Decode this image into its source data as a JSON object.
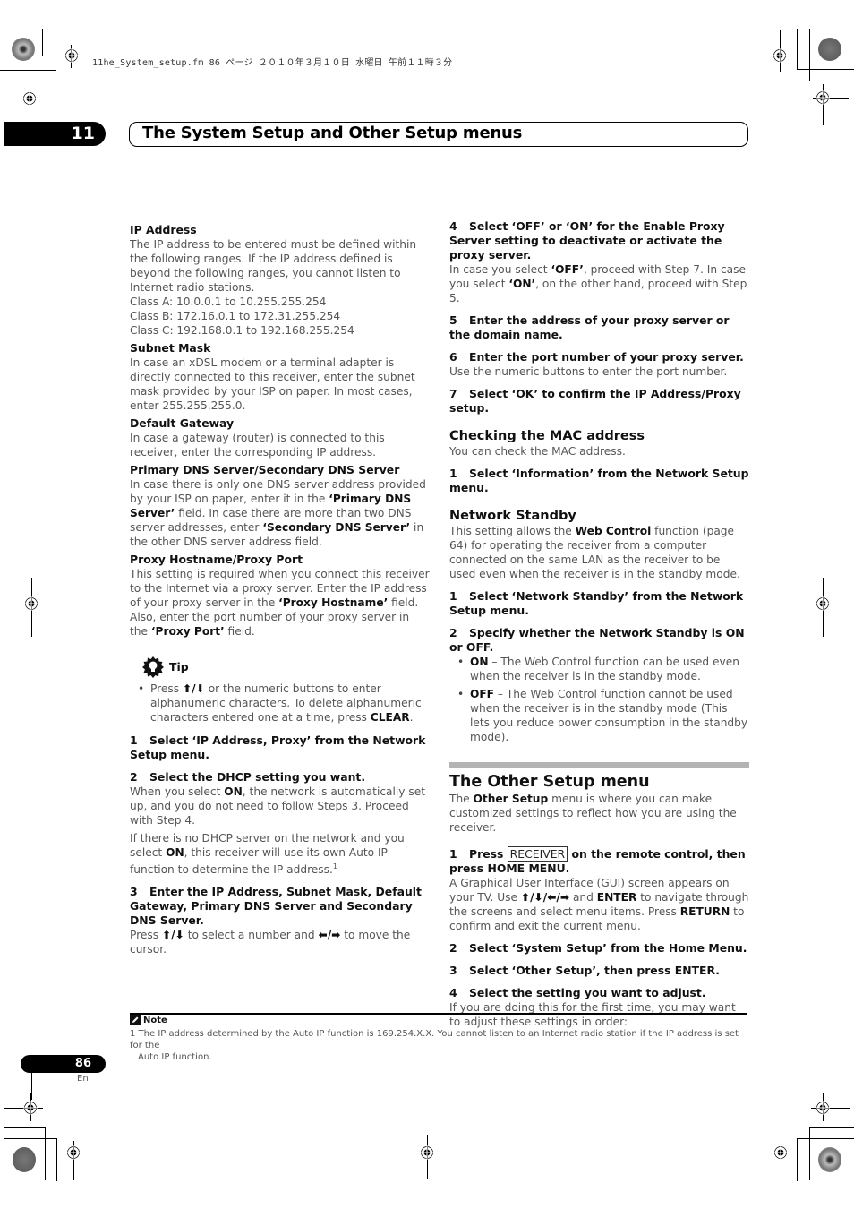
{
  "print_header": "11he_System_setup.fm  86 ページ  ２０１０年３月１０日  水曜日  午前１１時３分",
  "chapter": {
    "number": "11",
    "title": "The System Setup and Other Setup menus"
  },
  "left_column": {
    "ip_address": {
      "heading": "IP Address",
      "text": "The IP address to be entered must be defined within the following ranges. If the IP address defined is beyond the following ranges, you cannot listen to Internet radio stations.",
      "classes": [
        "Class A: 10.0.0.1 to 10.255.255.254",
        "Class B: 172.16.0.1 to 172.31.255.254",
        "Class C: 192.168.0.1 to 192.168.255.254"
      ]
    },
    "subnet_mask": {
      "heading": "Subnet Mask",
      "text": "In case an xDSL modem or a terminal adapter is directly connected to this receiver, enter the subnet mask provided by your ISP on paper. In most cases, enter 255.255.255.0."
    },
    "default_gateway": {
      "heading": "Default Gateway",
      "text": "In case a gateway (router) is connected to this receiver, enter the corresponding IP address."
    },
    "dns": {
      "heading": "Primary DNS Server/Secondary DNS Server",
      "text_1": "In case there is only one DNS server address provided by your ISP on paper, enter it in the ",
      "bold_1": "‘Primary DNS Server’",
      "text_2": " field. In case there are more than two DNS server addresses, enter ",
      "bold_2": "‘Secondary DNS Server’",
      "text_3": " in the other DNS server address field."
    },
    "proxy": {
      "heading": "Proxy Hostname/Proxy Port",
      "text_1": "This setting is required when you connect this receiver to the Internet via a proxy server. Enter the IP address of your proxy server in the ",
      "bold_1": "‘Proxy Hostname’",
      "text_2": " field. Also, enter the port number of your proxy server in the ",
      "bold_2": "‘Proxy Port’",
      "text_3": " field."
    },
    "tip": {
      "label": "Tip",
      "text_1": "Press ",
      "arrows": "⬆/⬇",
      "text_2": " or the numeric buttons to enter alphanumeric characters. To delete alphanumeric characters entered one at a time, press ",
      "bold": "CLEAR",
      "text_3": "."
    },
    "step1": {
      "num": "1",
      "text": "Select ‘IP Address, Proxy’ from the Network Setup menu."
    },
    "step2": {
      "num": "2",
      "text": "Select the DHCP setting you want.",
      "para1_a": "When you select ",
      "para1_b": "ON",
      "para1_c": ", the network is automatically set up, and you do not need to follow Steps 3. Proceed with Step 4.",
      "para2_a": "If there is no DHCP server on the network and you select ",
      "para2_b": "ON",
      "para2_c": ", this receiver will use its own Auto IP function to determine the IP address.",
      "footnote_ref": "1"
    },
    "step3": {
      "num": "3",
      "text": "Enter the IP Address, Subnet Mask, Default Gateway, Primary DNS Server and Secondary DNS Server.",
      "para_a": "Press ",
      "arrows_ud": "⬆/⬇",
      "para_b": " to select a number and ",
      "arrows_lr": "⬅/➡",
      "para_c": " to move the cursor."
    }
  },
  "right_column": {
    "step4": {
      "num": "4",
      "text": "Select ‘OFF’ or ‘ON’ for the Enable Proxy Server setting to deactivate or activate the proxy server.",
      "para_a": "In case you select ",
      "bold_off": "‘OFF’",
      "para_b": ", proceed with Step 7. In case you select ",
      "bold_on": "‘ON’",
      "para_c": ", on the other hand, proceed with Step 5."
    },
    "step5": {
      "num": "5",
      "text": "Enter the address of your proxy server or the domain name."
    },
    "step6": {
      "num": "6",
      "text": "Enter the port number of your proxy server.",
      "para": "Use the numeric buttons to enter the port number."
    },
    "step7": {
      "num": "7",
      "text": "Select ‘OK’ to confirm the IP Address/Proxy setup."
    },
    "mac": {
      "heading": "Checking the MAC address",
      "text": "You can check the MAC address.",
      "step_num": "1",
      "step_text": "Select ‘Information’ from the Network Setup menu."
    },
    "standby": {
      "heading": "Network Standby",
      "para_a": "This setting allows the ",
      "bold": "Web Control",
      "para_b": " function (page 64) for operating the receiver from a computer connected on the same LAN as the receiver to be used even when the receiver is in the standby mode.",
      "step1_num": "1",
      "step1_text": "Select ‘Network Standby’ from the Network Setup menu.",
      "step2_num": "2",
      "step2_text": "Specify whether the Network Standby is ON or OFF.",
      "bullets": [
        {
          "bold": "ON",
          "text": " – The Web Control function can be used even when the receiver is in the standby mode."
        },
        {
          "bold": "OFF",
          "text": " – The Web Control function cannot be used when the receiver is in the standby mode (This lets you reduce power consumption in the standby mode)."
        }
      ]
    },
    "other_setup": {
      "heading": "The Other Setup menu",
      "intro_a": "The ",
      "intro_bold": "Other Setup",
      "intro_b": " menu is where you can make customized settings to reflect how you are using the receiver.",
      "step1_num": "1",
      "step1_a": "Press ",
      "step1_key": "RECEIVER",
      "step1_b": " on the remote control, then press HOME MENU.",
      "step1_para_a": "A Graphical User Interface (GUI) screen appears on your TV. Use ",
      "step1_arrows": "⬆/⬇/⬅/➡",
      "step1_para_b": " and ",
      "step1_bold1": "ENTER",
      "step1_para_c": " to navigate through the screens and select menu items. Press ",
      "step1_bold2": "RETURN",
      "step1_para_d": " to confirm and exit the current menu.",
      "step2_num": "2",
      "step2_text": "Select ‘System Setup’ from the Home Menu.",
      "step3_num": "3",
      "step3_text": "Select ‘Other Setup’, then press ENTER.",
      "step4_num": "4",
      "step4_text": "Select the setting you want to adjust.",
      "step4_para": "If you are doing this for the first time, you may want to adjust these settings in order:"
    }
  },
  "note": {
    "label": "Note",
    "line1": "1 The IP address determined by the Auto IP function is 169.254.X.X. You cannot listen to an Internet radio station if the IP address is set for the",
    "line2": "Auto IP function."
  },
  "page": {
    "number": "86",
    "lang": "En"
  }
}
